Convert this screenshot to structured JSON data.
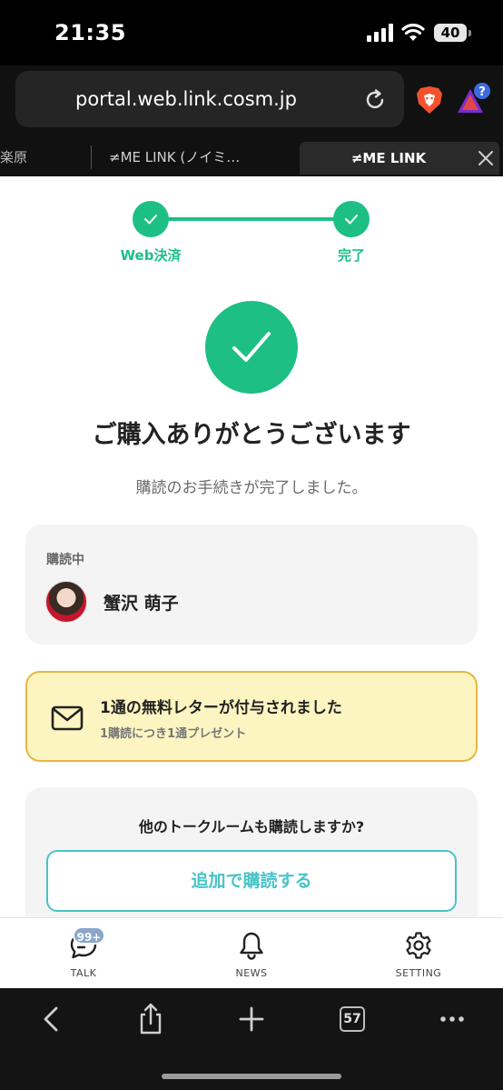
{
  "status_bar": {
    "time": "21:35",
    "battery": "40"
  },
  "browser": {
    "url": "portal.web.link.cosm.jp",
    "tabs": [
      {
        "label": "楽原"
      },
      {
        "label": "≠ME LINK (ノイミ…"
      },
      {
        "label": "≠ME LINK",
        "active": true
      }
    ],
    "rewards_badge": "?",
    "toolbar": {
      "tab_count": "57"
    }
  },
  "stepper": {
    "steps": [
      {
        "label": "Web決済"
      },
      {
        "label": "完了"
      }
    ],
    "accent_color": "#1dbf85"
  },
  "main": {
    "title": "ご購入ありがとうございます",
    "subtitle": "購読のお手続きが完了しました。",
    "subscription": {
      "label": "購読中",
      "member_name": "蟹沢 萌子"
    },
    "letter_notice": {
      "title": "1通の無料レターが付与されました",
      "description": "1購読につき1通プレゼント"
    },
    "more": {
      "question": "他のトークルームも購読しますか?",
      "button_label": "追加で購読する",
      "button_color": "#48c3c6"
    }
  },
  "app_nav": {
    "items": [
      {
        "label": "TALK",
        "icon": "chat-bubble-icon",
        "badge": "99+"
      },
      {
        "label": "NEWS",
        "icon": "bell-icon"
      },
      {
        "label": "SETTING",
        "icon": "gear-icon"
      }
    ]
  }
}
